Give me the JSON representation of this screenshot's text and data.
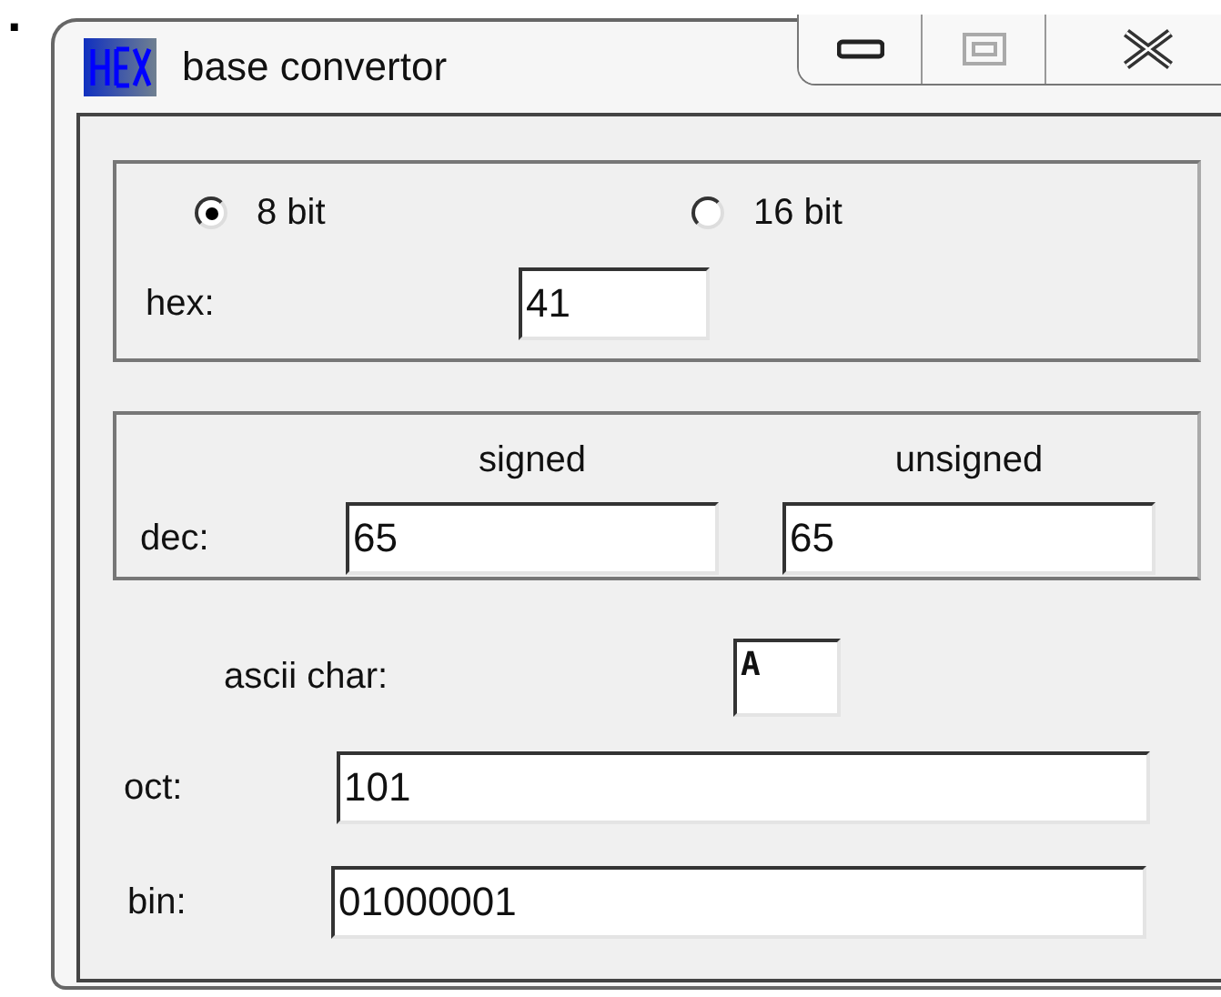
{
  "corner_label": ".",
  "window": {
    "title": "base convertor",
    "maximize_disabled": true
  },
  "bit_width": [
    {
      "label": "8 bit",
      "selected": true
    },
    {
      "label": "16 bit",
      "selected": false
    }
  ],
  "hex": {
    "label": "hex:",
    "value": "41"
  },
  "dec": {
    "label": "dec:",
    "columns": [
      "signed",
      "unsigned"
    ],
    "values": [
      "65",
      "65"
    ]
  },
  "ascii": {
    "label": "ascii char:",
    "value": "A"
  },
  "oct": {
    "label": "oct:",
    "value": "101"
  },
  "bin": {
    "label": "bin:",
    "value": "01000001"
  }
}
